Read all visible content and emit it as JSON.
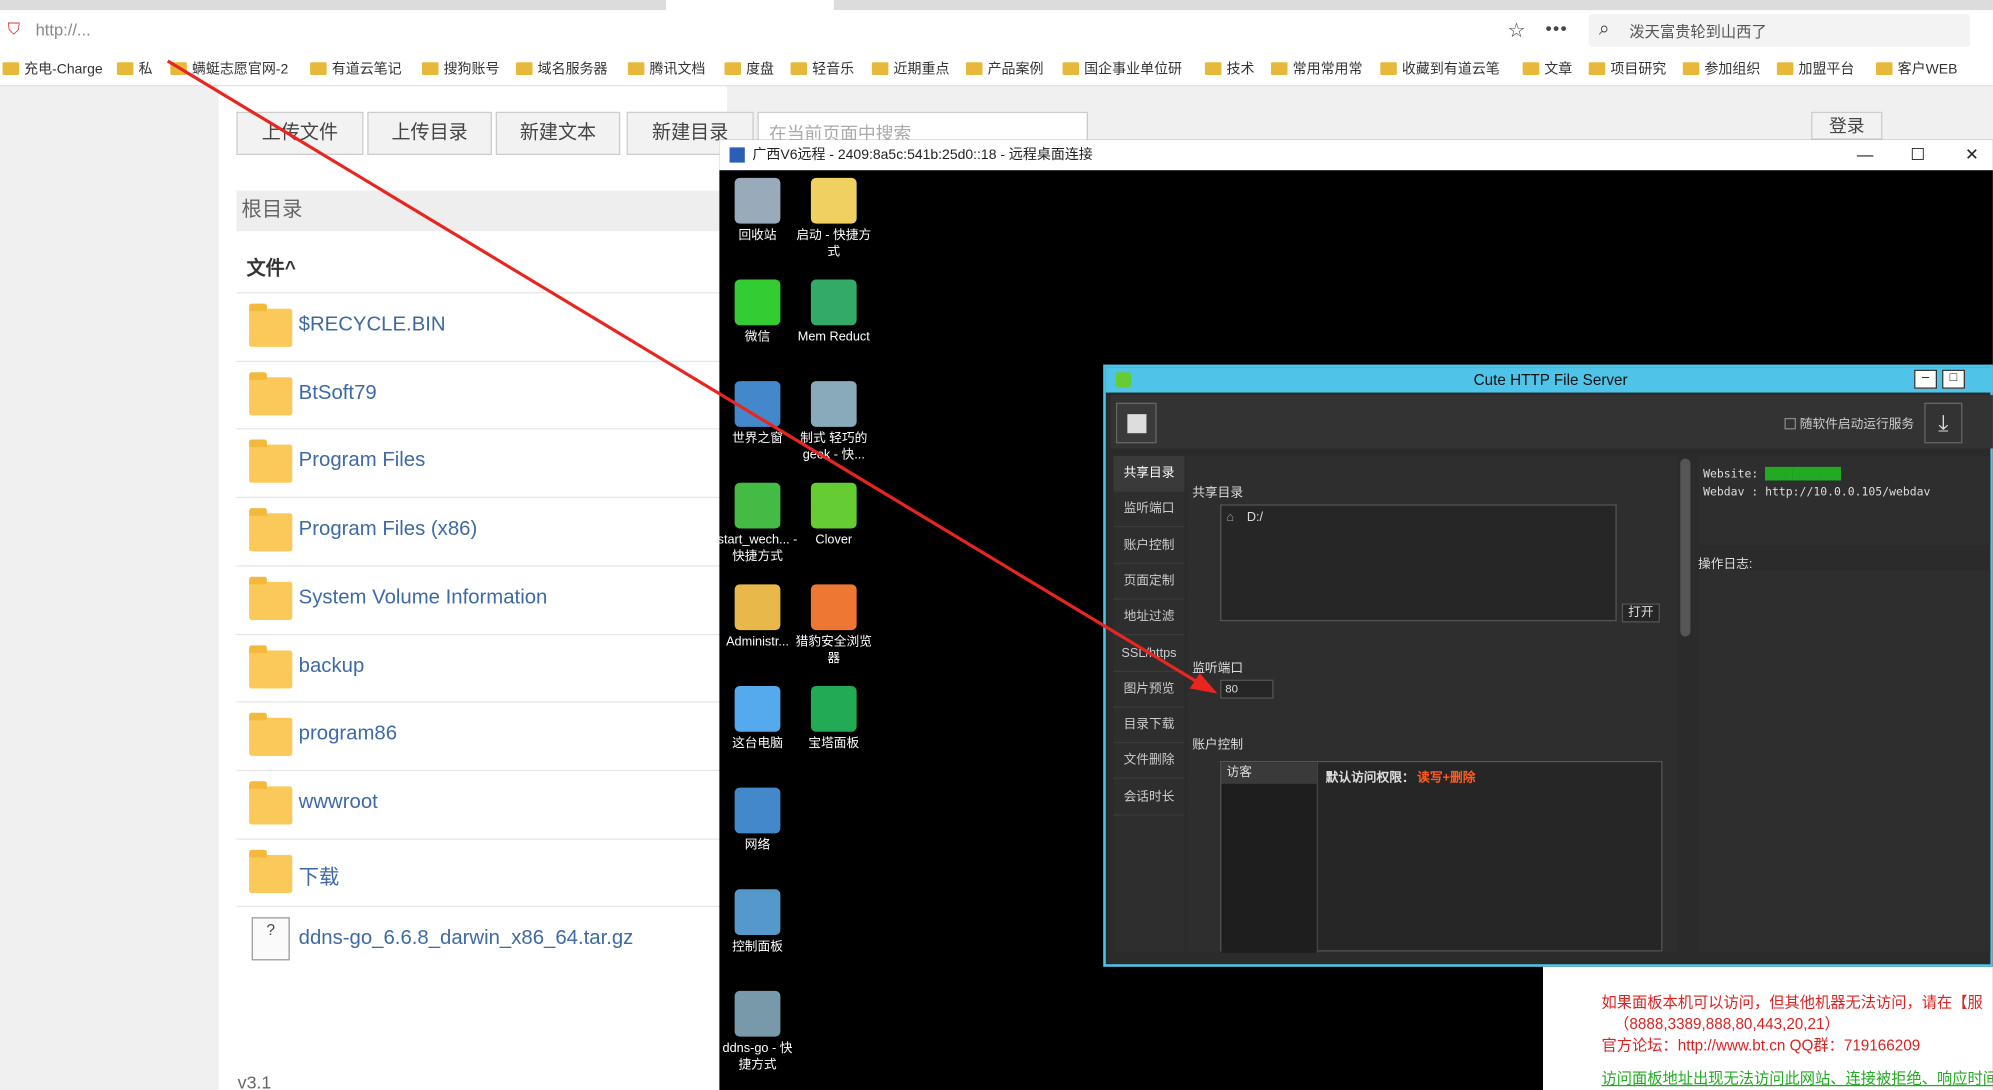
{
  "browser": {
    "url": "http://...",
    "search_text": "泼天富贵轮到山西了",
    "bookmarks": [
      "充电-Charge",
      "私",
      "螨蜓志愿官网-2",
      "有道云笔记",
      "搜狗账号",
      "域名服务器",
      "腾讯文档",
      "度盘",
      "轻音乐",
      "近期重点",
      "产品案例",
      "国企事业单位研",
      "技术",
      "常用常用常",
      "收藏到有道云笔",
      "文章",
      "项目研究",
      "参加组织",
      "加盟平台",
      "客户WEB"
    ]
  },
  "filepage": {
    "buttons": [
      "上传文件",
      "上传目录",
      "新建文本",
      "新建目录"
    ],
    "search_placeholder": "在当前页面中搜索",
    "login": "登录",
    "breadcrumb": "根目录",
    "file_header": "文件^",
    "files": [
      "$RECYCLE.BIN",
      "BtSoft79",
      "Program Files",
      "Program Files (x86)",
      "System Volume Information",
      "backup",
      "program86",
      "wwwroot",
      "下载",
      "ddns-go_6.6.8_darwin_x86_64.tar.gz"
    ],
    "version": "v3.1"
  },
  "remote": {
    "title": "广西V6远程 - 2409:8a5c:541b:25d0::18 - 远程桌面连接",
    "icons": [
      {
        "label": "回收站",
        "color": "#9ab"
      },
      {
        "label": "启动 - 快捷方式",
        "color": "#f0d060"
      },
      {
        "label": "微信",
        "color": "#3c3"
      },
      {
        "label": "Mem Reduct",
        "color": "#3a6"
      },
      {
        "label": "世界之窗",
        "color": "#48c"
      },
      {
        "label": "制式 轻巧的 geek - 快...",
        "color": "#8ab"
      },
      {
        "label": "start_wech... - 快捷方式",
        "color": "#4b4"
      },
      {
        "label": "Clover",
        "color": "#6c3"
      },
      {
        "label": "Administr...",
        "color": "#e9b84a"
      },
      {
        "label": "猎豹安全浏览器",
        "color": "#e73"
      },
      {
        "label": "这台电脑",
        "color": "#5ae"
      },
      {
        "label": "宝塔面板",
        "color": "#2a5"
      },
      {
        "label": "网络",
        "color": "#48c"
      },
      {
        "label": "控制面板",
        "color": "#59c"
      },
      {
        "label": "ddns-go - 快捷方式",
        "color": "#79a"
      }
    ]
  },
  "hfs": {
    "title": "Cute HTTP File Server",
    "autostart": "随软件启动运行服务",
    "nav": [
      "共享目录",
      "监听端口",
      "账户控制",
      "页面定制",
      "地址过滤",
      "SSL/https",
      "图片预览",
      "目录下载",
      "文件删除",
      "会话时长"
    ],
    "share_label": "共享目录",
    "share_path": "D:/",
    "open_btn": "打开",
    "port_label": "监听端口",
    "port_value": "80",
    "account_label": "账户控制",
    "guest": "访客",
    "default_perm": "默认访问权限：",
    "perm_value": "读写+删除",
    "website_label": "Website: ",
    "webdav": "Webdav : http://10.0.0.105/webdav",
    "log_label": "操作日志:"
  },
  "bt": {
    "line1": "如果面板本机可以访问，但其他机器无法访问，请在【服",
    "line2": "（8888,3389,888,80,443,20,21）",
    "line3": "官方论坛：http://www.bt.cn  QQ群：719166209",
    "line4": "访问面板地址出现无法访问此网站、连接被拒绝、响应时间过"
  },
  "colors": {
    "accent": "#4fc3e8",
    "arrow": "#e8261f",
    "link": "#3d6aa6",
    "warn": "#ff5a1f"
  }
}
